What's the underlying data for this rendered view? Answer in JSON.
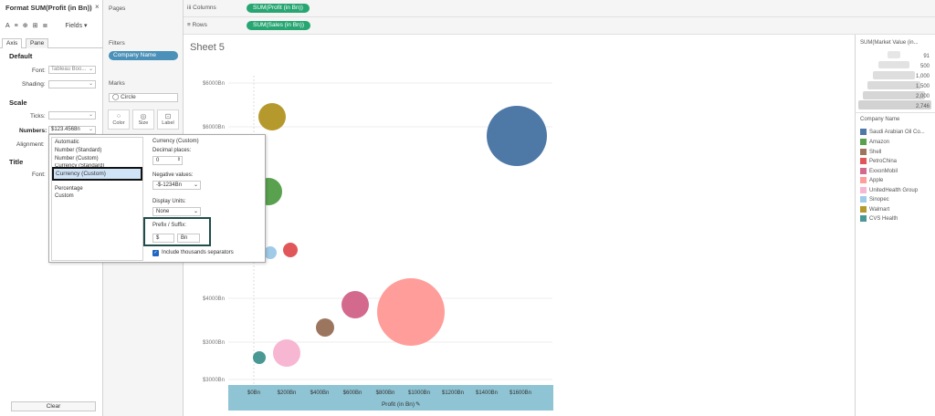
{
  "format_pane": {
    "title": "Format SUM(Profit (in Bn))",
    "close": "×",
    "toolbar_icons": [
      "A",
      "≡",
      "⊕",
      "⊞",
      "≣"
    ],
    "fields_label": "Fields ▾",
    "tabs": [
      "Axis",
      "Pane"
    ],
    "default_label": "Default",
    "font_label": "Font:",
    "font_value": "Tableau Boo...",
    "shading_label": "Shading:",
    "scale_label": "Scale",
    "ticks_label": "Ticks:",
    "numbers_label": "Numbers:",
    "numbers_value": "$123.4568n",
    "alignment_label": "Alignment:",
    "title_label": "Title",
    "title_font_label": "Font:",
    "clear_label": "Clear"
  },
  "shelves": {
    "pages_label": "Pages",
    "filters_label": "Filters",
    "filter_pill": "Company Name",
    "marks_label": "Marks",
    "marks_type": "◯ Circle",
    "mark_buttons": [
      "Color",
      "Size",
      "Label"
    ],
    "columns_label": "iii Columns",
    "columns_pill": "SUM(Profit (in Bn))",
    "rows_label": "≡ Rows",
    "rows_pill": "SUM(Sales (in Bn))"
  },
  "sheet": {
    "title": "Sheet 5",
    "y_ticks": [
      "$6000Bn",
      "$6000Bn",
      "$4000Bn",
      "$3000Bn",
      "$3000Bn"
    ],
    "x_ticks": [
      "$0Bn",
      "$200Bn",
      "$400Bn",
      "$600Bn",
      "$800Bn",
      "$1000Bn",
      "$1200Bn",
      "$1400Bn",
      "$1600Bn"
    ],
    "x_title": "Profit (in Bn)"
  },
  "size_legend": {
    "title": "SUM(Market Value (in...",
    "values": [
      "91",
      "500",
      "1,000",
      "1,500",
      "2,000",
      "2,746"
    ]
  },
  "color_legend": {
    "title": "Company Name",
    "items": [
      {
        "label": "Saudi Arabian Oil Co...",
        "color": "#4e79a7"
      },
      {
        "label": "Amazon",
        "color": "#59a14f"
      },
      {
        "label": "Shell",
        "color": "#9c755f"
      },
      {
        "label": "PetroChina",
        "color": "#e15759"
      },
      {
        "label": "ExxonMobil",
        "color": "#d4698e"
      },
      {
        "label": "Apple",
        "color": "#ff9d9a"
      },
      {
        "label": "UnitedHealth Group",
        "color": "#f7b6d2"
      },
      {
        "label": "Sinopec",
        "color": "#a0cbe8"
      },
      {
        "label": "Walmart",
        "color": "#b6992d"
      },
      {
        "label": "CVS Health",
        "color": "#499894"
      }
    ]
  },
  "popup": {
    "formats": [
      "Automatic",
      "Number (Standard)",
      "Number (Custom)",
      "Currency (Standard)",
      "Currency (Custom)",
      "Percentage",
      "Custom"
    ],
    "selected": "Currency (Custom)",
    "section_title": "Currency (Custom)",
    "decimal_label": "Decimal places:",
    "decimal_value": "0",
    "negative_label": "Negative values:",
    "negative_value": "-$-1234Bn",
    "display_units_label": "Display Units:",
    "display_units_value": "None",
    "prefix_suffix_label": "Prefix / Suffix:",
    "prefix_value": "$",
    "suffix_value": "Bn",
    "thousands_label": "Include thousands separators"
  }
}
